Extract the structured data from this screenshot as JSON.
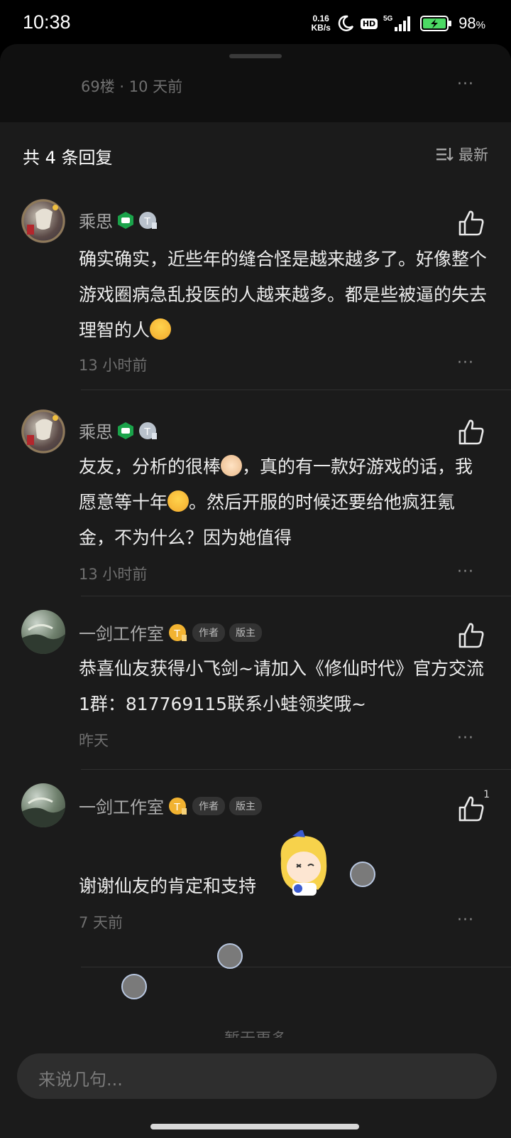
{
  "status_bar": {
    "time": "10:38",
    "net_speed_value": "0.16",
    "net_speed_unit": "KB/s",
    "hd": "HD",
    "signal": "5G",
    "battery": "98",
    "battery_unit": "%"
  },
  "floor_header": {
    "meta": "69楼 · 10 天前",
    "more": "···"
  },
  "replies_header": {
    "count_label": "共 4 条回复",
    "sort_label": "最新"
  },
  "comments": [
    {
      "username": "乘思",
      "content_a": "确实确实，近些年的缝合怪是越来越多了。好像整个游戏圈病急乱投医的人越来越多。都是些被逼的失去理智的人",
      "content_b": "",
      "content_c": "",
      "time": "13 小时前",
      "likes": ""
    },
    {
      "username": "乘思",
      "content_a": "友友，分析的很棒",
      "content_b": "，真的有一款好游戏的话，我愿意等十年",
      "content_c": "。然后开服的时候还要给他疯狂氪金，不为什么？因为她值得",
      "time": "13 小时前",
      "likes": ""
    },
    {
      "username": "一剑工作室",
      "tag_author": "作者",
      "tag_mod": "版主",
      "content_a": "恭喜仙友获得小飞剑~请加入《修仙时代》官方交流1群：817769115联系小蛙领奖哦~",
      "time": "昨天",
      "likes": ""
    },
    {
      "username": "一剑工作室",
      "tag_author": "作者",
      "tag_mod": "版主",
      "content_a": "谢谢仙友的肯定和支持",
      "time": "7 天前",
      "likes": "1"
    }
  ],
  "more_glyph": "···",
  "no_more": "暂无更多",
  "input": {
    "placeholder": "来说几句..."
  }
}
